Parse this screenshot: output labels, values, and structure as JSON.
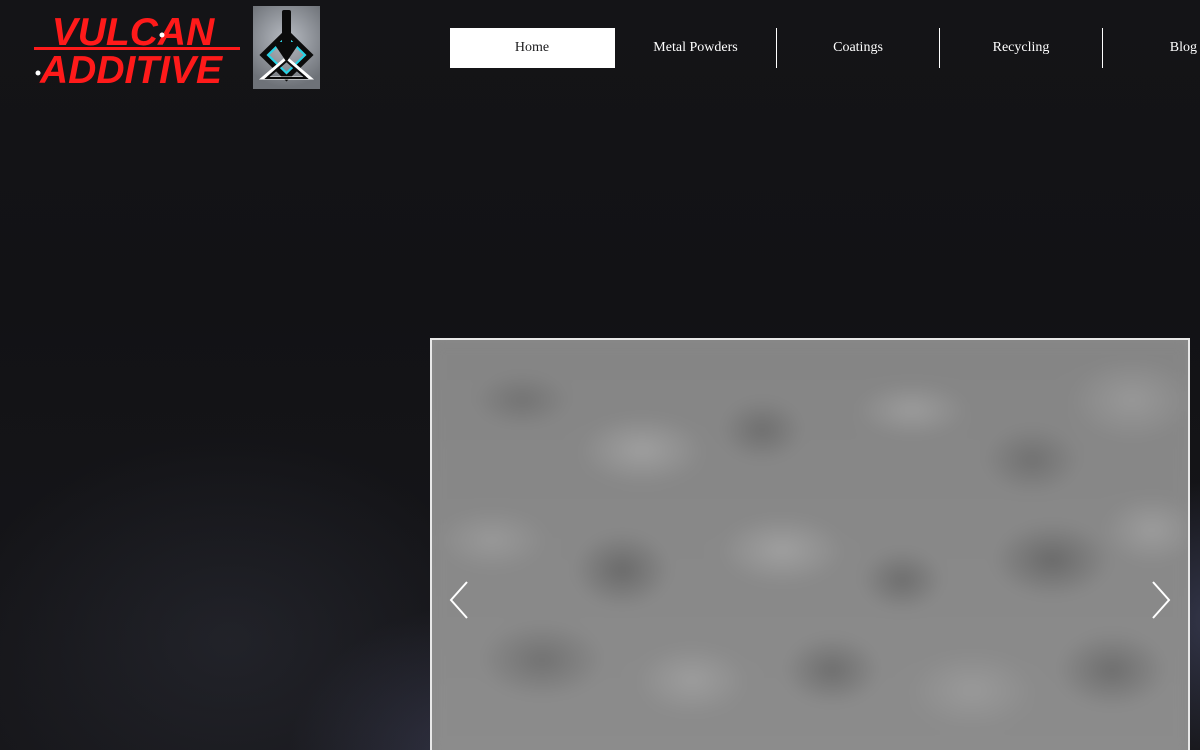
{
  "brand": {
    "line1": "VULCAN",
    "line2": "ADDITIVE",
    "text_color": "#ff1a1a",
    "emblem_accent": "#23d5e8"
  },
  "nav": {
    "items": [
      {
        "label": "Home",
        "active": true
      },
      {
        "label": "Metal Powders",
        "active": false
      },
      {
        "label": "Coatings",
        "active": false
      },
      {
        "label": "Recycling",
        "active": false
      },
      {
        "label": "Blog",
        "active": false
      }
    ]
  },
  "slideshow": {
    "prev_icon": "chevron-left-icon",
    "next_icon": "chevron-right-icon"
  }
}
